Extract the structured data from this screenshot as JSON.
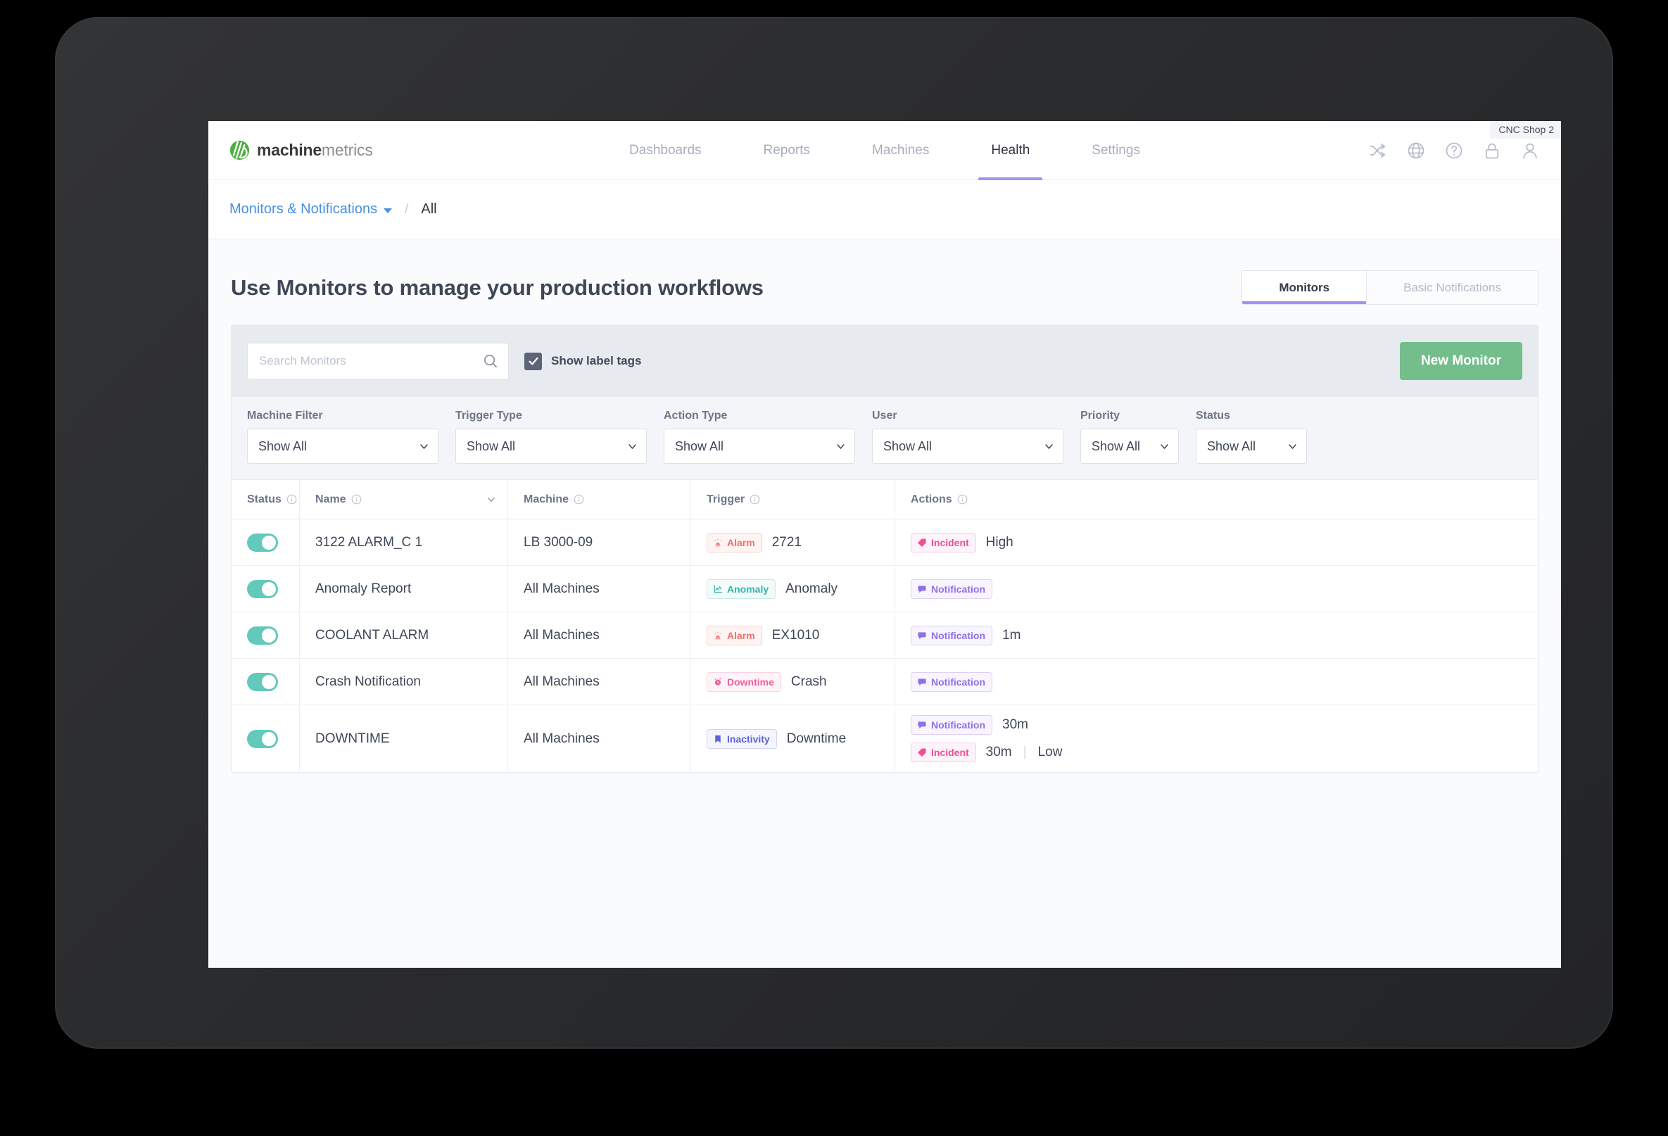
{
  "account": {
    "label": "CNC Shop 2"
  },
  "brand": {
    "bold": "machine",
    "light": "metrics"
  },
  "nav": {
    "items": [
      {
        "label": "Dashboards",
        "active": false
      },
      {
        "label": "Reports",
        "active": false
      },
      {
        "label": "Machines",
        "active": false
      },
      {
        "label": "Health",
        "active": true
      },
      {
        "label": "Settings",
        "active": false
      }
    ],
    "icons": [
      "shuffle-icon",
      "globe-icon",
      "help-circle-icon",
      "lock-icon",
      "user-icon"
    ]
  },
  "breadcrumb": {
    "link": "Monitors & Notifications",
    "separator": "/",
    "current": "All"
  },
  "page": {
    "title": "Use Monitors to manage your production workflows"
  },
  "segmented": {
    "tabs": [
      {
        "label": "Monitors",
        "active": true
      },
      {
        "label": "Basic Notifications",
        "active": false
      }
    ]
  },
  "toolbar": {
    "search_placeholder": "Search Monitors",
    "search_value": "",
    "show_label_tags": "Show label tags",
    "show_label_tags_checked": true,
    "new_monitor": "New Monitor",
    "accent_green": "#74be8c"
  },
  "filters": [
    {
      "label": "Machine Filter",
      "value": "Show All"
    },
    {
      "label": "Trigger Type",
      "value": "Show All"
    },
    {
      "label": "Action Type",
      "value": "Show All"
    },
    {
      "label": "User",
      "value": "Show All"
    },
    {
      "label": "Priority",
      "value": "Show All"
    },
    {
      "label": "Status",
      "value": "Show All"
    }
  ],
  "table": {
    "columns": [
      {
        "label": "Status",
        "info": true,
        "sortable": false
      },
      {
        "label": "Name",
        "info": true,
        "sortable": true
      },
      {
        "label": "Machine",
        "info": true,
        "sortable": false
      },
      {
        "label": "Trigger",
        "info": true,
        "sortable": false
      },
      {
        "label": "Actions",
        "info": true,
        "sortable": false
      }
    ],
    "rows": [
      {
        "enabled": true,
        "name": "3122 ALARM_C 1",
        "machine": "LB 3000-09",
        "trigger": {
          "badge": "Alarm",
          "kind": "alarm",
          "value": "2721"
        },
        "actions": [
          {
            "badge": "Incident",
            "kind": "incident",
            "values": [
              "High"
            ]
          }
        ]
      },
      {
        "enabled": true,
        "name": "Anomaly Report",
        "machine": "All Machines",
        "trigger": {
          "badge": "Anomaly",
          "kind": "anomaly",
          "value": "Anomaly"
        },
        "actions": [
          {
            "badge": "Notification",
            "kind": "notification",
            "values": []
          }
        ]
      },
      {
        "enabled": true,
        "name": "COOLANT ALARM",
        "machine": "All Machines",
        "trigger": {
          "badge": "Alarm",
          "kind": "alarm",
          "value": "EX1010"
        },
        "actions": [
          {
            "badge": "Notification",
            "kind": "notification",
            "values": [
              "1m"
            ]
          }
        ]
      },
      {
        "enabled": true,
        "name": "Crash Notification",
        "machine": "All Machines",
        "trigger": {
          "badge": "Downtime",
          "kind": "downtime",
          "value": "Crash"
        },
        "actions": [
          {
            "badge": "Notification",
            "kind": "notification",
            "values": []
          }
        ]
      },
      {
        "enabled": true,
        "name": "DOWNTIME",
        "machine": "All Machines",
        "trigger": {
          "badge": "Inactivity",
          "kind": "inactivity",
          "value": "Downtime"
        },
        "actions": [
          {
            "badge": "Notification",
            "kind": "notification",
            "values": [
              "30m"
            ]
          },
          {
            "badge": "Incident",
            "kind": "incident",
            "values": [
              "30m",
              "Low"
            ]
          }
        ]
      }
    ]
  }
}
